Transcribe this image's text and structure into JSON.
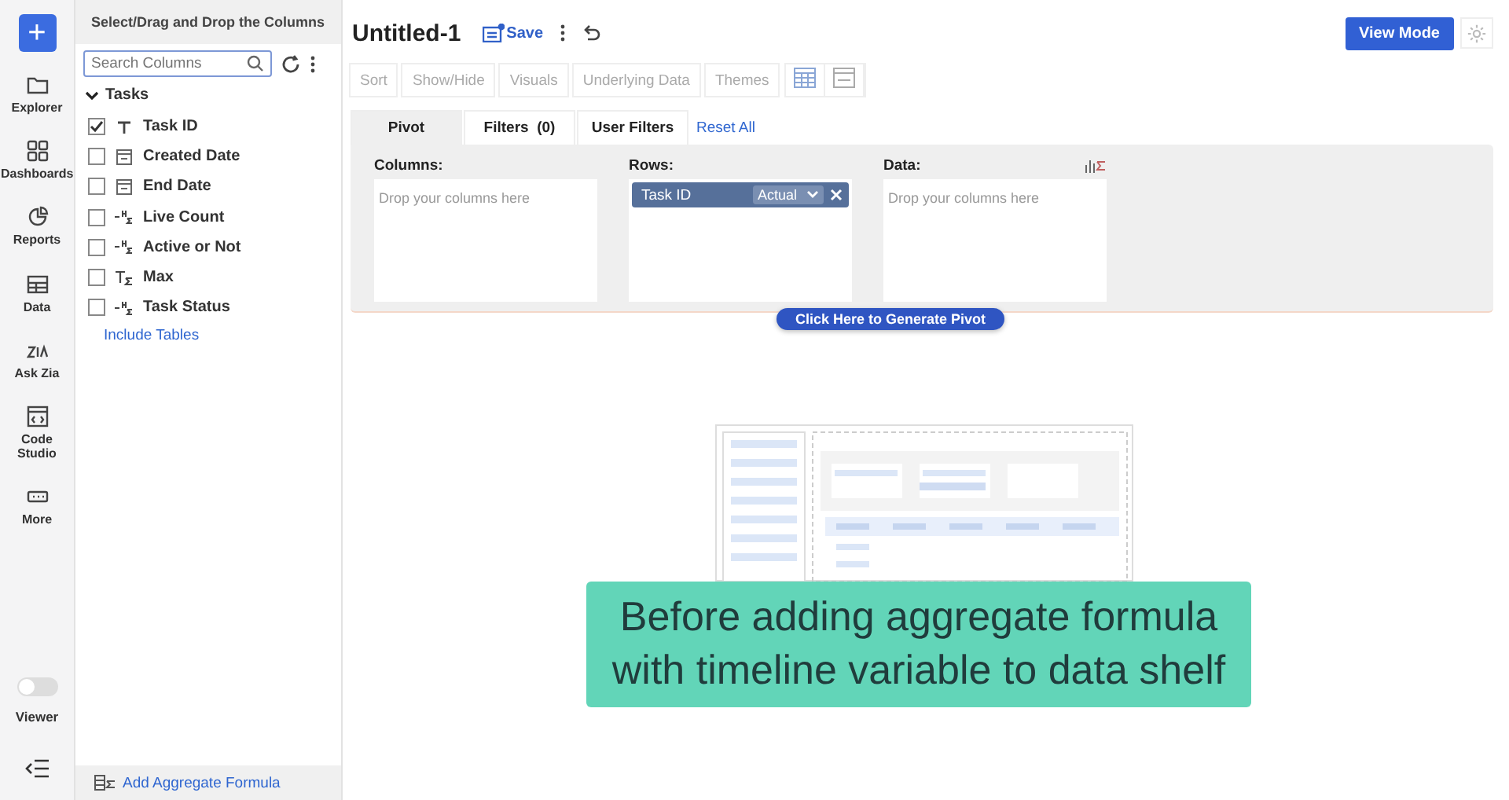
{
  "rail": {
    "new_button": "+",
    "items": [
      {
        "label": "Explorer"
      },
      {
        "label": "Dashboards"
      },
      {
        "label": "Reports"
      },
      {
        "label": "Data"
      },
      {
        "label": "Ask Zia"
      },
      {
        "label": "Code Studio"
      },
      {
        "label": "More"
      }
    ],
    "viewer": {
      "label": "Viewer",
      "on": false
    }
  },
  "column_panel": {
    "title": "Select/Drag and Drop the Columns",
    "search": {
      "placeholder": "Search Columns"
    },
    "table": {
      "name": "Tasks",
      "expanded": true,
      "columns": [
        {
          "name": "Task ID",
          "checked": true,
          "kind": "text"
        },
        {
          "name": "Created Date",
          "checked": false,
          "kind": "date"
        },
        {
          "name": "End Date",
          "checked": false,
          "kind": "date"
        },
        {
          "name": "Live Count",
          "checked": false,
          "kind": "formula"
        },
        {
          "name": "Active or Not",
          "checked": false,
          "kind": "formula"
        },
        {
          "name": "Max",
          "checked": false,
          "kind": "aggregate"
        },
        {
          "name": "Task Status",
          "checked": false,
          "kind": "formula"
        }
      ]
    },
    "include_tables": "Include Tables",
    "add_formula": "Add Aggregate Formula"
  },
  "header": {
    "title": "Untitled-1",
    "save": "Save",
    "view_mode": "View Mode"
  },
  "toolbar": [
    {
      "label": "Sort",
      "disabled": true
    },
    {
      "label": "Show/Hide",
      "disabled": true
    },
    {
      "label": "Visuals",
      "disabled": true
    },
    {
      "label": "Underlying Data",
      "disabled": true
    },
    {
      "label": "Themes",
      "disabled": true
    }
  ],
  "tabs": [
    {
      "label": "Pivot",
      "selected": true
    },
    {
      "label": "Filters  (0)",
      "selected": false
    },
    {
      "label": "User Filters",
      "selected": false
    }
  ],
  "reset_all": "Reset All",
  "shelves": [
    {
      "label": "Columns:",
      "placeholder": "Drop your columns here"
    },
    {
      "label": "Rows:",
      "chips": [
        {
          "name": "Task ID",
          "option": "Actual"
        }
      ]
    },
    {
      "label": "Data:",
      "placeholder": "Drop your columns here"
    }
  ],
  "generate_button": "Click Here to Generate Pivot",
  "caption": "Before adding aggregate formula with timeline variable to data shelf"
}
